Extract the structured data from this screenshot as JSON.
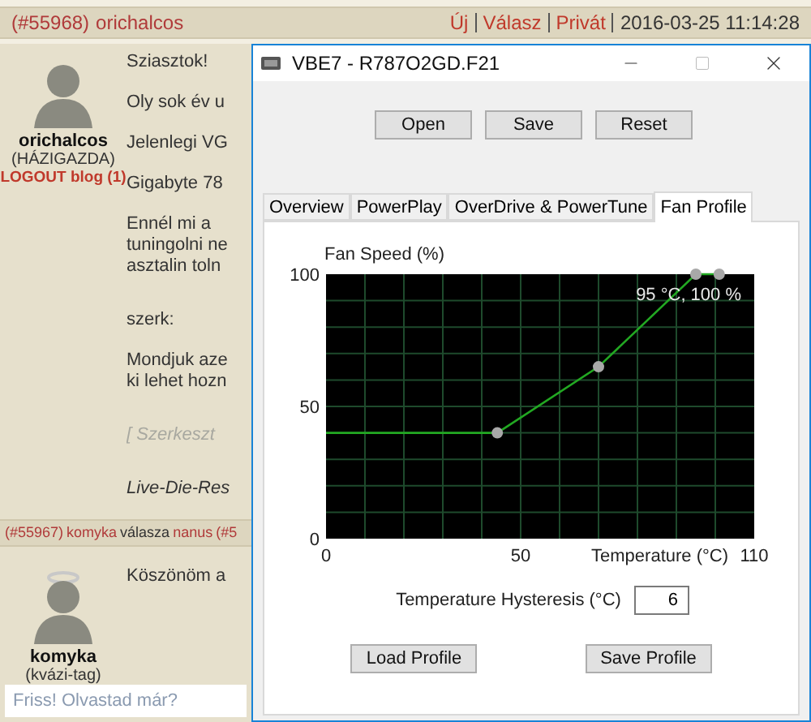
{
  "post_header": {
    "id": "(#55968)",
    "author": "orichalcos",
    "links": [
      "Új",
      "Válasz",
      "Privát"
    ],
    "timestamp": "2016-03-25 11:14:28"
  },
  "post": {
    "author": "orichalcos",
    "rank": "(HÁZIGAZDA)",
    "blog_link": "LOGOUT blog (1)",
    "paragraphs": [
      {
        "kind": "text",
        "lines": [
          "Sziasztok!"
        ]
      },
      {
        "kind": "text",
        "lines": [
          "Oly sok év u"
        ]
      },
      {
        "kind": "text",
        "lines": [
          "Jelenlegi VG"
        ]
      },
      {
        "kind": "text",
        "lines": [
          "Gigabyte 78"
        ]
      },
      {
        "kind": "text",
        "lines": [
          "Ennél mi a",
          "tuningolni ne",
          "asztalin toln"
        ]
      },
      {
        "kind": "text",
        "lines": [
          "szerk:"
        ]
      },
      {
        "kind": "text",
        "lines": [
          "Mondjuk aze",
          "ki lehet hozn"
        ]
      },
      {
        "kind": "note",
        "lines": [
          "[ Szerkeszt"
        ]
      },
      {
        "kind": "signature",
        "lines": [
          "Live-Die-Res"
        ]
      }
    ]
  },
  "reply_header": {
    "id": "(#55967)",
    "author": "komyka",
    "connector": "válasza",
    "target": "nanus",
    "target_id": "(#5"
  },
  "reply": {
    "author": "komyka",
    "rank": "(kvázi-tag)",
    "paragraphs": [
      {
        "kind": "text",
        "lines": [
          "Köszönöm a"
        ]
      }
    ]
  },
  "comment_field": {
    "placeholder": "Friss! Olvastad már?"
  },
  "dialog": {
    "title": "VBE7 - R787O2GD.F21",
    "toolbar_buttons": [
      "Open",
      "Save",
      "Reset"
    ],
    "tabs": [
      {
        "label": "Overview",
        "selected": false
      },
      {
        "label": "PowerPlay",
        "selected": false
      },
      {
        "label": "OverDrive & PowerTune",
        "selected": false
      },
      {
        "label": "Fan Profile",
        "selected": true
      }
    ],
    "chart_data": {
      "type": "line",
      "xlabel": "Temperature (°C)",
      "ylabel": "Fan Speed (%)",
      "x": [
        0,
        44,
        70,
        95,
        101
      ],
      "series": [
        {
          "color": "#22a822",
          "marker": "circle",
          "values": [
            40,
            40,
            65,
            100,
            100
          ]
        }
      ],
      "xlim": [
        0,
        110
      ],
      "ylim": [
        0,
        100
      ],
      "xticks": [
        0,
        50,
        110
      ],
      "yticks": [
        0,
        50,
        100
      ],
      "annotations": [
        {
          "text": "95 °C, 100 %"
        }
      ]
    },
    "hysteresis": {
      "label": "Temperature Hysteresis (°C)",
      "value": "6"
    },
    "profile_buttons": [
      "Load Profile",
      "Save Profile"
    ]
  }
}
